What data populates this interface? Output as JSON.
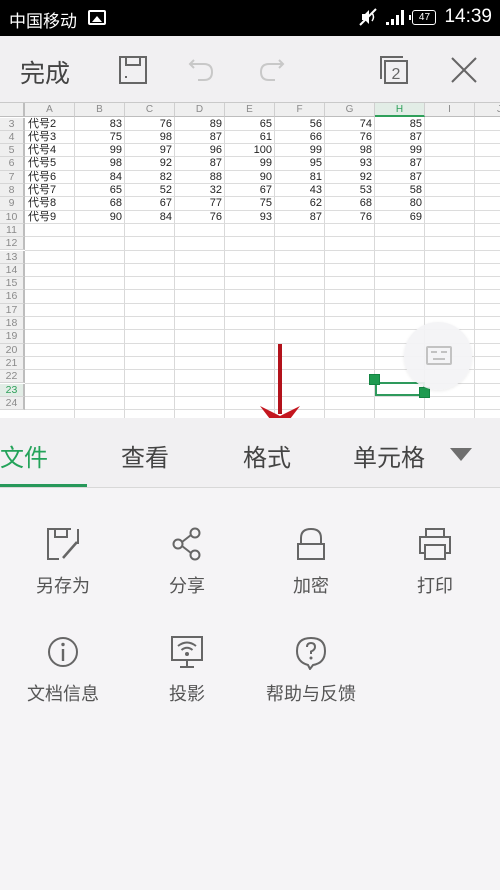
{
  "status_bar": {
    "carrier": "中国移动",
    "battery": "47",
    "time": "14:39",
    "icons": [
      "image-notification-icon",
      "mute-icon",
      "signal-icon",
      "battery-icon"
    ]
  },
  "toolbar": {
    "done_label": "完成",
    "icons": [
      "save-icon",
      "undo-icon",
      "redo-icon",
      "window-switch-icon",
      "close-icon"
    ],
    "window_count": "2"
  },
  "spreadsheet": {
    "columns": [
      "A",
      "B",
      "C",
      "D",
      "E",
      "F",
      "G",
      "H",
      "I",
      "J"
    ],
    "selected_column": "H",
    "selected_row": "23",
    "rows": [
      {
        "num": "3",
        "cells": [
          "代号2",
          "83",
          "76",
          "89",
          "65",
          "56",
          "74",
          "85"
        ]
      },
      {
        "num": "4",
        "cells": [
          "代号3",
          "75",
          "98",
          "87",
          "61",
          "66",
          "76",
          "87"
        ]
      },
      {
        "num": "5",
        "cells": [
          "代号4",
          "99",
          "97",
          "96",
          "100",
          "99",
          "98",
          "99"
        ]
      },
      {
        "num": "6",
        "cells": [
          "代号5",
          "98",
          "92",
          "87",
          "99",
          "95",
          "93",
          "87"
        ]
      },
      {
        "num": "7",
        "cells": [
          "代号6",
          "84",
          "82",
          "88",
          "90",
          "81",
          "92",
          "87"
        ]
      },
      {
        "num": "8",
        "cells": [
          "代号7",
          "65",
          "52",
          "32",
          "67",
          "43",
          "53",
          "58"
        ]
      },
      {
        "num": "9",
        "cells": [
          "代号8",
          "68",
          "67",
          "77",
          "75",
          "62",
          "68",
          "80"
        ]
      },
      {
        "num": "10",
        "cells": [
          "代号9",
          "90",
          "84",
          "76",
          "93",
          "87",
          "76",
          "69"
        ]
      },
      {
        "num": "11",
        "cells": []
      },
      {
        "num": "12",
        "cells": []
      },
      {
        "num": "13",
        "cells": []
      },
      {
        "num": "14",
        "cells": []
      },
      {
        "num": "15",
        "cells": []
      },
      {
        "num": "16",
        "cells": []
      },
      {
        "num": "17",
        "cells": []
      },
      {
        "num": "18",
        "cells": []
      },
      {
        "num": "19",
        "cells": []
      },
      {
        "num": "20",
        "cells": []
      },
      {
        "num": "21",
        "cells": []
      },
      {
        "num": "22",
        "cells": []
      },
      {
        "num": "23",
        "cells": []
      },
      {
        "num": "24",
        "cells": []
      }
    ]
  },
  "floating_button": {
    "icon": "keyboard-icon"
  },
  "annotation": {
    "icon": "red-down-arrow",
    "color": "#b3121b"
  },
  "tabs": {
    "items": [
      {
        "label": "文件",
        "active": true
      },
      {
        "label": "查看",
        "active": false
      },
      {
        "label": "格式",
        "active": false
      },
      {
        "label": "单元格",
        "active": false
      }
    ],
    "more_icon": "dropdown-triangle-icon",
    "accent_color": "#24a35a"
  },
  "file_menu": {
    "items": [
      {
        "label": "另存为",
        "icon": "save-as-icon"
      },
      {
        "label": "分享",
        "icon": "share-icon"
      },
      {
        "label": "加密",
        "icon": "lock-icon"
      },
      {
        "label": "打印",
        "icon": "print-icon"
      },
      {
        "label": "文档信息",
        "icon": "info-icon"
      },
      {
        "label": "投影",
        "icon": "projection-icon"
      },
      {
        "label": "帮助与反馈",
        "icon": "help-feedback-icon"
      }
    ]
  }
}
